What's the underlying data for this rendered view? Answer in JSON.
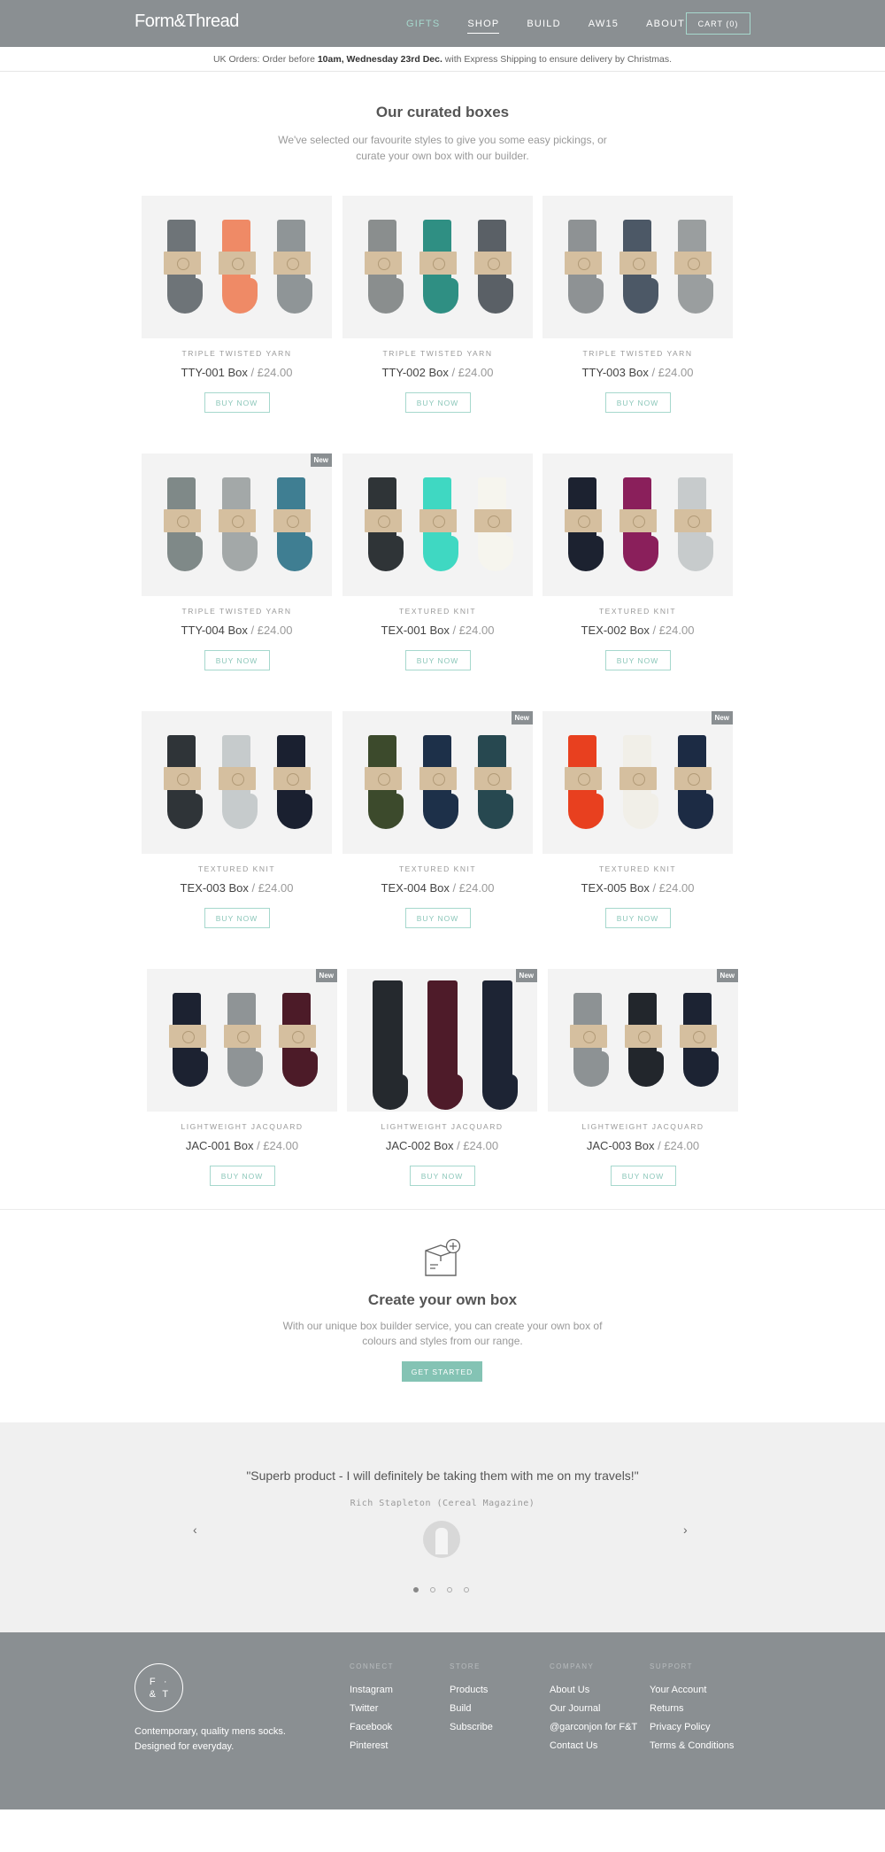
{
  "header": {
    "logo": "Form&Thread",
    "nav": [
      "GIFTS",
      "SHOP",
      "BUILD",
      "AW15",
      "ABOUT"
    ],
    "cart": "CART (0)"
  },
  "banner": {
    "prefix": "UK Orders: Order before ",
    "bold": "10am, Wednesday 23rd Dec.",
    "suffix": " with Express Shipping to ensure delivery by Christmas."
  },
  "intro": {
    "title": "Our curated boxes",
    "text": "We've selected our favourite styles to give you some easy pickings, or curate your own box with our builder."
  },
  "buy_label": "BUY NOW",
  "new_label": "New",
  "products": [
    {
      "category": "TRIPLE TWISTED YARN",
      "name": "TTY-001 Box",
      "price": "£24.00",
      "is_new": false,
      "colors": [
        "#6e7478",
        "#ef8a66",
        "#8f9597"
      ]
    },
    {
      "category": "TRIPLE TWISTED YARN",
      "name": "TTY-002 Box",
      "price": "£24.00",
      "is_new": false,
      "colors": [
        "#8a8e8e",
        "#2f8f83",
        "#5a6066"
      ]
    },
    {
      "category": "TRIPLE TWISTED YARN",
      "name": "TTY-003 Box",
      "price": "£24.00",
      "is_new": false,
      "colors": [
        "#8e9294",
        "#4c5866",
        "#9a9e9f"
      ]
    },
    {
      "category": "TRIPLE TWISTED YARN",
      "name": "TTY-004 Box",
      "price": "£24.00",
      "is_new": true,
      "colors": [
        "#7f8988",
        "#a3a8a8",
        "#3f7e92"
      ]
    },
    {
      "category": "TEXTURED KNIT",
      "name": "TEX-001 Box",
      "price": "£24.00",
      "is_new": false,
      "colors": [
        "#2f3437",
        "#3fd8c2",
        "#f6f5ee"
      ]
    },
    {
      "category": "TEXTURED KNIT",
      "name": "TEX-002 Box",
      "price": "£24.00",
      "is_new": false,
      "colors": [
        "#1c2230",
        "#8a1f5b",
        "#c7cbcc"
      ]
    },
    {
      "category": "TEXTURED KNIT",
      "name": "TEX-003 Box",
      "price": "£24.00",
      "is_new": false,
      "colors": [
        "#2f3438",
        "#c6cbcc",
        "#1a2030"
      ]
    },
    {
      "category": "TEXTURED KNIT",
      "name": "TEX-004 Box",
      "price": "£24.00",
      "is_new": true,
      "colors": [
        "#3c4a2c",
        "#1d3049",
        "#274850"
      ]
    },
    {
      "category": "TEXTURED KNIT",
      "name": "TEX-005 Box",
      "price": "£24.00",
      "is_new": true,
      "colors": [
        "#e8401f",
        "#f1efe8",
        "#1c2b44"
      ]
    },
    {
      "category": "LIGHTWEIGHT JACQUARD",
      "name": "JAC-001 Box",
      "price": "£24.00",
      "is_new": true,
      "colors": [
        "#1c2231",
        "#8f9496",
        "#4c1b28"
      ]
    },
    {
      "category": "LIGHTWEIGHT JACQUARD",
      "name": "JAC-002 Box",
      "price": "£24.00",
      "is_new": true,
      "tall": true,
      "colors": [
        "#25292e",
        "#4e1b29",
        "#1d2434"
      ]
    },
    {
      "category": "LIGHTWEIGHT JACQUARD",
      "name": "JAC-003 Box",
      "price": "£24.00",
      "is_new": true,
      "colors": [
        "#8d9294",
        "#22262c",
        "#1c2333"
      ]
    }
  ],
  "create": {
    "title": "Create your own box",
    "text": "With our unique box builder service, you can create your own box of colours and styles from our range.",
    "button": "GET STARTED"
  },
  "testimonial": {
    "quote": "\"Superb product - I will definitely be taking them with me on my travels!\"",
    "author": "Rich Stapleton (Cereal Magazine)",
    "prev": "‹",
    "next": "›",
    "active_dot": 0,
    "dot_count": 4
  },
  "footer": {
    "logo_letters": [
      "F",
      "·",
      "&",
      "T"
    ],
    "tagline_1": "Contemporary, quality mens socks.",
    "tagline_2": "Designed for everyday.",
    "columns": [
      {
        "heading": "CONNECT",
        "links": [
          "Instagram",
          "Twitter",
          "Facebook",
          "Pinterest"
        ]
      },
      {
        "heading": "STORE",
        "links": [
          "Products",
          "Build",
          "Subscribe"
        ]
      },
      {
        "heading": "COMPANY",
        "links": [
          "About Us",
          "Our Journal",
          "@garconjon for F&T",
          "Contact Us"
        ]
      },
      {
        "heading": "SUPPORT",
        "links": [
          "Your Account",
          "Returns",
          "Privacy Policy",
          "Terms & Conditions"
        ]
      }
    ]
  },
  "colors": {
    "header_bg": "#8a8f92",
    "accent": "#a6d8cd",
    "button_fill": "#84c3b4"
  }
}
